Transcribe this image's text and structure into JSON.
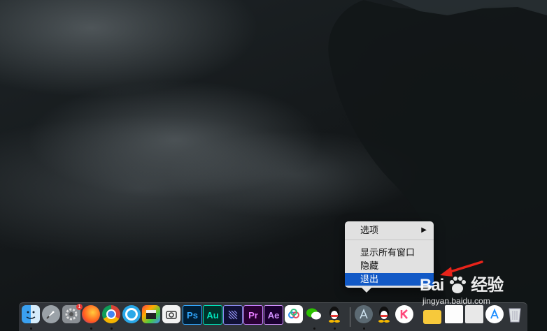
{
  "context_menu": {
    "items": [
      {
        "label": "选项",
        "has_submenu": true,
        "submenu_arrow": "▶"
      },
      {
        "label": "显示所有窗口"
      },
      {
        "label": "隐藏"
      },
      {
        "label": "退出",
        "highlighted": true
      }
    ]
  },
  "dock": {
    "apps": [
      {
        "name": "finder-icon",
        "running": true
      },
      {
        "name": "launchpad-icon",
        "running": false
      },
      {
        "name": "system-preferences-icon",
        "running": false,
        "badge": "1"
      },
      {
        "name": "firefox-icon",
        "running": true
      },
      {
        "name": "chrome-icon",
        "running": true
      },
      {
        "name": "browser-q-icon",
        "running": false
      },
      {
        "name": "final-cut-pro-icon",
        "running": false
      },
      {
        "name": "screenshot-app-icon",
        "running": false
      },
      {
        "name": "photoshop-icon",
        "label": "Ps",
        "running": false
      },
      {
        "name": "audition-icon",
        "label": "Au",
        "running": false
      },
      {
        "name": "media-encoder-icon",
        "running": false
      },
      {
        "name": "premiere-icon",
        "label": "Pr",
        "running": false
      },
      {
        "name": "after-effects-icon",
        "label": "Ae",
        "running": false
      },
      {
        "name": "baidu-netdisk-icon",
        "running": false
      },
      {
        "name": "wechat-icon",
        "running": true
      },
      {
        "name": "qq-icon",
        "running": true
      },
      {
        "name": "app-store-like-icon",
        "running": true
      },
      {
        "name": "qq-icon-2",
        "running": false
      },
      {
        "name": "kwai-k-icon",
        "running": false
      },
      {
        "name": "folder-icon",
        "running": false
      },
      {
        "name": "documents-stack-icon",
        "running": false
      },
      {
        "name": "image-stack-icon",
        "running": false
      },
      {
        "name": "app-store-icon",
        "running": false
      },
      {
        "name": "trash-icon",
        "running": false
      }
    ]
  },
  "watermark": {
    "brand": "Bai",
    "brand_suffix": "经验",
    "url": "jingyan.baidu.com"
  },
  "colors": {
    "menu_highlight": "#1259c6",
    "annotation_arrow": "#e8231a"
  }
}
